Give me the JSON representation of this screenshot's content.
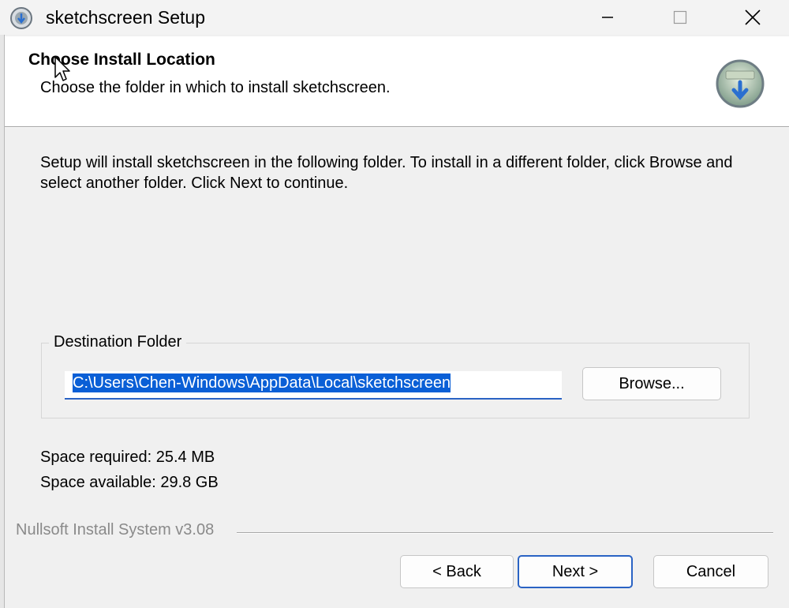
{
  "window": {
    "title": "sketchscreen Setup"
  },
  "header": {
    "title": "Choose Install Location",
    "subtitle": "Choose the folder in which to install sketchscreen."
  },
  "body": {
    "intro": "Setup will install sketchscreen in the following folder. To install in a different folder, click Browse and select another folder. Click Next to continue.",
    "destination": {
      "legend": "Destination Folder",
      "path": "C:\\Users\\Chen-Windows\\AppData\\Local\\sketchscreen",
      "browse_label": "Browse..."
    },
    "space_required": "Space required: 25.4 MB",
    "space_available": "Space available: 29.8 GB"
  },
  "footer": {
    "branding": "Nullsoft Install System v3.08",
    "back_label": "< Back",
    "next_label": "Next >",
    "cancel_label": "Cancel"
  },
  "colors": {
    "accent": "#2a63c4",
    "selection": "#0a5fd6"
  }
}
